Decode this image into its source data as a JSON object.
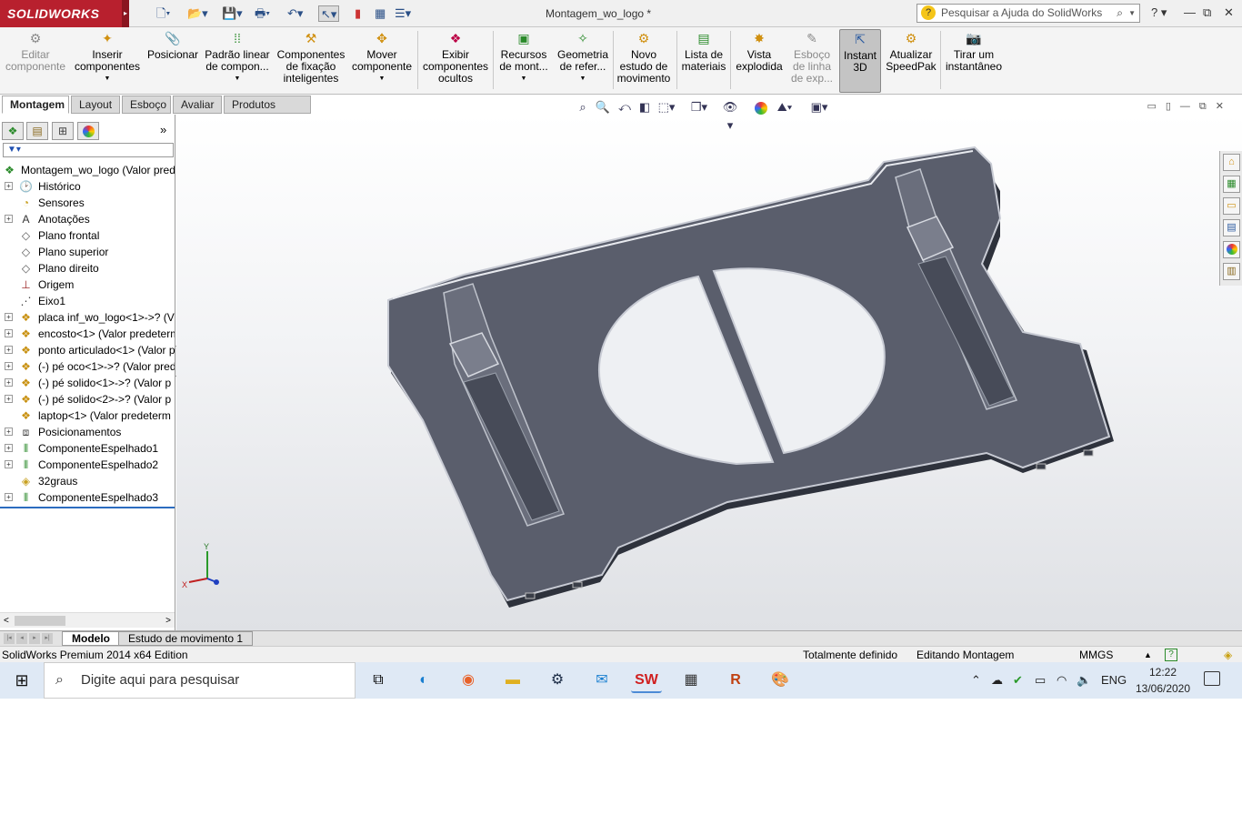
{
  "app": {
    "brand": "SOLIDWORKS",
    "document_title": "Montagem_wo_logo *",
    "search_placeholder": "Pesquisar a Ajuda do SolidWorks"
  },
  "ribbon": {
    "buttons": [
      {
        "label": "Editar\ncomponente",
        "disabled": true
      },
      {
        "label": "Inserir\ncomponentes",
        "disabled": false
      },
      {
        "label": "Posicionar",
        "disabled": false
      },
      {
        "label": "Padrão linear\nde compon...",
        "disabled": false
      },
      {
        "label": "Componentes\nde fixação\ninteligentes",
        "disabled": false
      },
      {
        "label": "Mover\ncomponente",
        "disabled": false
      },
      {
        "label": "Exibir\ncomponentes\nocultos",
        "disabled": false
      },
      {
        "label": "Recursos\nde mont...",
        "disabled": false
      },
      {
        "label": "Geometria\nde refer...",
        "disabled": false
      },
      {
        "label": "Novo\nestudo de\nmovimento",
        "disabled": false
      },
      {
        "label": "Lista de\nmateriais",
        "disabled": false
      },
      {
        "label": "Vista\nexplodida",
        "disabled": false
      },
      {
        "label": "Esboço\nde linha\nde exp...",
        "disabled": true
      },
      {
        "label": "Instant\n3D",
        "disabled": false,
        "active": true
      },
      {
        "label": "Atualizar\nSpeedPak",
        "disabled": false
      },
      {
        "label": "Tirar um\ninstantâneo",
        "disabled": false
      }
    ]
  },
  "command_tabs": [
    "Montagem",
    "Layout",
    "Esboço",
    "Avaliar",
    "Produtos Office"
  ],
  "tree": {
    "root": "Montagem_wo_logo  (Valor pred",
    "items": [
      {
        "label": "Histórico",
        "icon": "history-icon",
        "expand": true
      },
      {
        "label": "Sensores",
        "icon": "sensor-icon",
        "expand": false
      },
      {
        "label": "Anotações",
        "icon": "annotation-icon",
        "expand": true
      },
      {
        "label": "Plano frontal",
        "icon": "plane-icon",
        "expand": false
      },
      {
        "label": "Plano superior",
        "icon": "plane-icon",
        "expand": false
      },
      {
        "label": "Plano direito",
        "icon": "plane-icon",
        "expand": false
      },
      {
        "label": "Origem",
        "icon": "origin-icon",
        "expand": false
      },
      {
        "label": "Eixo1",
        "icon": "axis-icon",
        "expand": false
      },
      {
        "label": "placa inf_wo_logo<1>->? (V",
        "icon": "part-icon",
        "expand": true
      },
      {
        "label": "encosto<1> (Valor predeterm",
        "icon": "part-icon",
        "expand": true
      },
      {
        "label": "ponto articulado<1> (Valor p",
        "icon": "part-icon",
        "expand": true
      },
      {
        "label": "(-) pé oco<1>->? (Valor pred",
        "icon": "part-icon",
        "expand": true
      },
      {
        "label": "(-) pé solido<1>->? (Valor p",
        "icon": "part-icon",
        "expand": true
      },
      {
        "label": "(-) pé solido<2>->? (Valor p",
        "icon": "part-icon",
        "expand": true
      },
      {
        "label": "laptop<1> (Valor predeterm",
        "icon": "part-icon",
        "expand": false
      },
      {
        "label": "Posicionamentos",
        "icon": "mates-icon",
        "expand": true
      },
      {
        "label": "ComponenteEspelhado1",
        "icon": "mirror-icon",
        "expand": true
      },
      {
        "label": "ComponenteEspelhado2",
        "icon": "mirror-icon",
        "expand": true
      },
      {
        "label": "32graus",
        "icon": "angle-icon",
        "expand": false
      },
      {
        "label": "ComponenteEspelhado3",
        "icon": "mirror-icon",
        "expand": true
      }
    ]
  },
  "bottom_tabs": [
    "Modelo",
    "Estudo de movimento 1"
  ],
  "status": {
    "edition": "SolidWorks Premium 2014 x64 Edition",
    "definition": "Totalmente definido",
    "mode": "Editando Montagem",
    "units": "MMGS"
  },
  "triad": {
    "x": "X",
    "y": "Y"
  },
  "taskbar": {
    "search_placeholder": "Digite aqui para pesquisar",
    "lang": "ENG",
    "time": "12:22",
    "date": "13/06/2020"
  },
  "colors": {
    "model": "#5a5e6c",
    "model_edge": "#c8cbd4",
    "brand": "#b8202e"
  }
}
